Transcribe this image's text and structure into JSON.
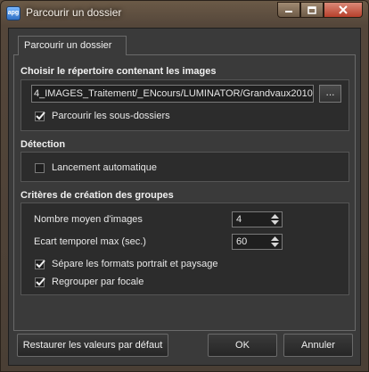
{
  "window": {
    "title": "Parcourir un dossier",
    "icon_name": "app-icon",
    "icon_text": "apg"
  },
  "tab": {
    "label": "Parcourir un dossier"
  },
  "folder": {
    "heading": "Choisir le répertoire contenant les images",
    "path": "4_IMAGES_Traitement/_ENcours/LUMINATOR/Grandvaux2010",
    "browse_label": "...",
    "subfolders_label": "Parcourir les sous-dossiers",
    "subfolders_checked": true
  },
  "detection": {
    "heading": "Détection",
    "auto_label": "Lancement automatique",
    "auto_checked": false
  },
  "groups": {
    "heading": "Critères de création des groupes",
    "avg_images_label": "Nombre moyen d'images",
    "avg_images_value": "4",
    "time_gap_label": "Ecart temporel max (sec.)",
    "time_gap_value": "60",
    "split_formats_label": "Sépare les formats portrait et paysage",
    "split_formats_checked": true,
    "group_focal_label": "Regrouper par focale",
    "group_focal_checked": true
  },
  "footer": {
    "restore_label": "Restaurer les valeurs par défaut",
    "ok_label": "OK",
    "cancel_label": "Annuler"
  },
  "colors": {
    "window_frame": "#54463a",
    "client_bg": "#3a3a3a",
    "close_red": "#b8402c"
  }
}
